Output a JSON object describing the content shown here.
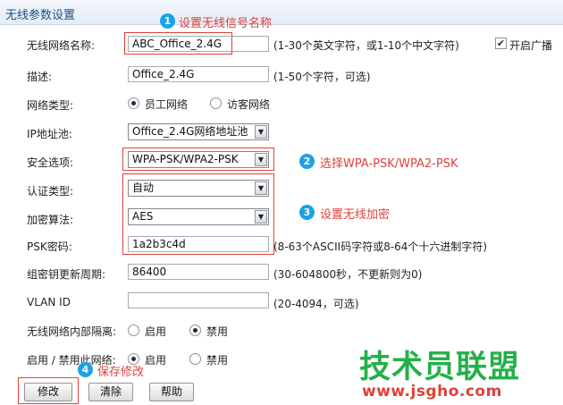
{
  "header": {
    "title": "无线参数设置"
  },
  "form": {
    "ssid": {
      "label": "无线网络名称:",
      "value": "ABC_Office_2.4G",
      "hint": "(1-30个英文字符，或1-10个中文字符)"
    },
    "broadcast": {
      "label": "开启广播",
      "checked": true
    },
    "description": {
      "label": "描述:",
      "value": "Office_2.4G",
      "hint": "(1-50个字符，可选)"
    },
    "network_type": {
      "label": "网络类型:",
      "options": [
        "员工网络",
        "访客网络"
      ],
      "selected": "员工网络"
    },
    "ip_pool": {
      "label": "IP地址池:",
      "value": "Office_2.4G网络地址池"
    },
    "security": {
      "label": "安全选项:",
      "value": "WPA-PSK/WPA2-PSK"
    },
    "auth_type": {
      "label": "认证类型:",
      "value": "自动"
    },
    "encryption": {
      "label": "加密算法:",
      "value": "AES"
    },
    "psk": {
      "label": "PSK密码:",
      "value": "1a2b3c4d",
      "hint": "(8-63个ASCII码字符或8-64个十六进制字符)"
    },
    "group_key": {
      "label": "组密钥更新周期:",
      "value": "86400",
      "hint": "(30-604800秒，不更新则为0)"
    },
    "vlan": {
      "label": "VLAN ID",
      "value": "",
      "hint": "(20-4094，可选)"
    },
    "isolation": {
      "label": "无线网络内部隔离:",
      "options": [
        "启用",
        "禁用"
      ],
      "selected": "禁用"
    },
    "enable": {
      "label": "启用 / 禁用此网络:",
      "options": [
        "启用",
        "禁用"
      ],
      "selected": "启用"
    }
  },
  "buttons": {
    "modify": "修改",
    "clear": "清除",
    "help": "帮助"
  },
  "annotations": {
    "a1": {
      "num": "1",
      "text": "设置无线信号名称"
    },
    "a2": {
      "num": "2",
      "text": "选择WPA-PSK/WPA2-PSK"
    },
    "a3": {
      "num": "3",
      "text": "设置无线加密"
    },
    "a4": {
      "num": "4",
      "text": "保存修改"
    }
  },
  "watermark": {
    "name": "技术员联盟",
    "url": "www.jsgho.com"
  },
  "colors": {
    "accent_red": "#e0403a",
    "badge_blue": "#1aa3e6",
    "watermark_green": "#23b04a"
  }
}
